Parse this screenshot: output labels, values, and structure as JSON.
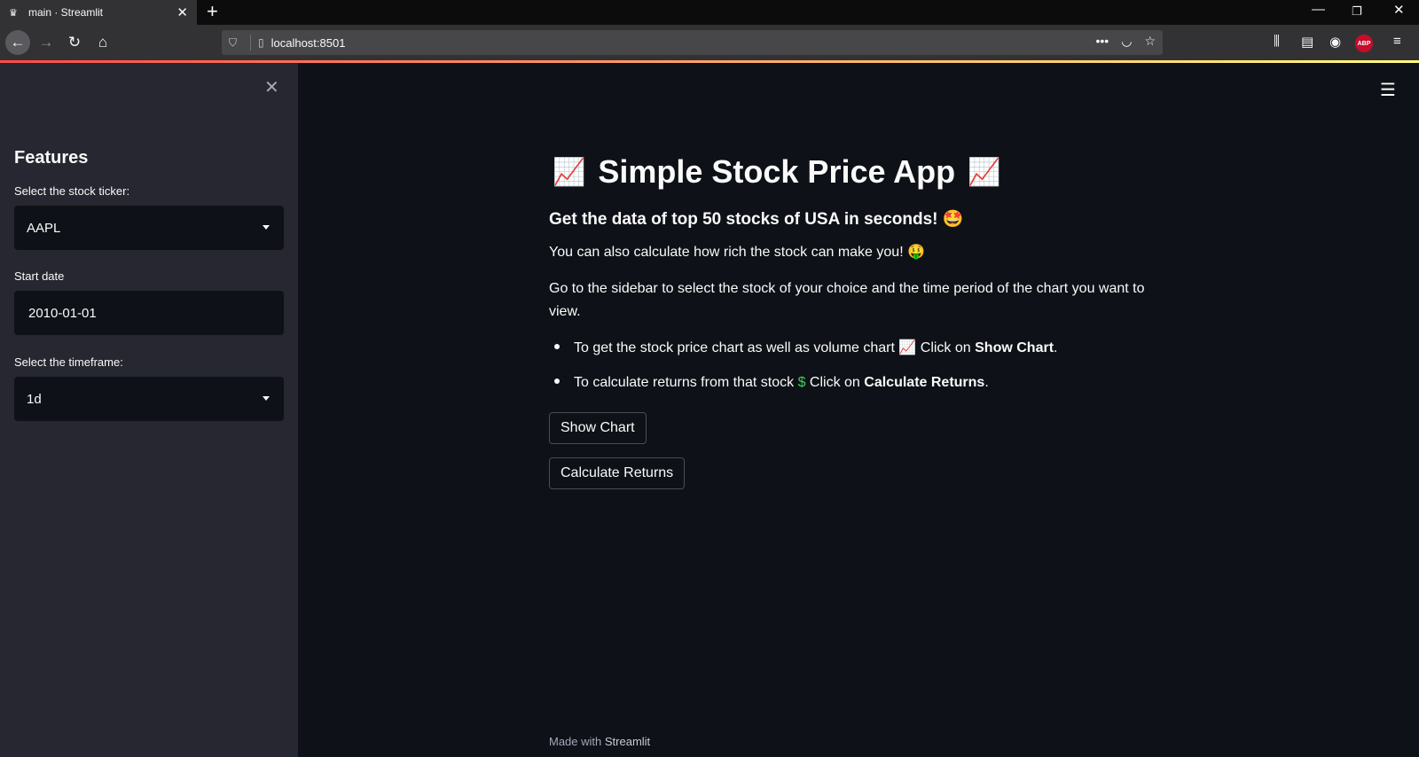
{
  "browser": {
    "tab_title": "main · Streamlit",
    "tab_favicon": "♛",
    "url": "localhost:8501",
    "abp_label": "ABP"
  },
  "sidebar": {
    "title": "Features",
    "ticker_label": "Select the stock ticker:",
    "ticker_value": "AAPL",
    "start_date_label": "Start date",
    "start_date_value": "2010-01-01",
    "timeframe_label": "Select the timeframe:",
    "timeframe_value": "1d"
  },
  "main": {
    "title": "Simple Stock Price App",
    "title_icon": "📈",
    "subtitle": "Get the data of top 50 stocks of USA in seconds!",
    "subtitle_emoji": "🤩",
    "para1": "You can also calculate how rich the stock can make you!",
    "para1_emoji": "🤑",
    "para2": "Go to the sidebar to select the stock of your choice and the time period of the chart you want to view.",
    "bullet1_text": "To get the stock price chart as well as volume chart",
    "bullet1_emoji": "📈",
    "bullet1_click": "Click on",
    "bullet1_bold": "Show Chart",
    "bullet2_text": "To calculate returns from that stock",
    "bullet2_emoji": "$",
    "bullet2_click": "Click on",
    "bullet2_bold": "Calculate Returns",
    "show_chart_button": "Show Chart",
    "calculate_returns_button": "Calculate Returns",
    "footer_prefix": "Made with",
    "footer_brand": "Streamlit"
  }
}
